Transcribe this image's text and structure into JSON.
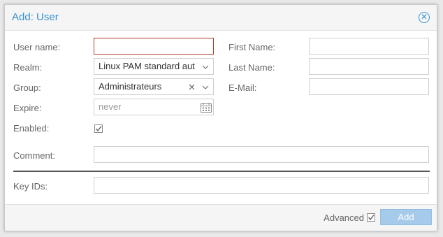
{
  "dialog": {
    "title": "Add: User",
    "close_icon": "close-circle-icon"
  },
  "form": {
    "user_name": {
      "label": "User name:",
      "value": ""
    },
    "realm": {
      "label": "Realm:",
      "value": "Linux PAM standard aut"
    },
    "group": {
      "label": "Group:",
      "value": "Administrateurs"
    },
    "expire": {
      "label": "Expire:",
      "placeholder": "never"
    },
    "enabled": {
      "label": "Enabled:",
      "checked": true
    },
    "first_name": {
      "label": "First Name:",
      "value": ""
    },
    "last_name": {
      "label": "Last Name:",
      "value": ""
    },
    "email": {
      "label": "E-Mail:",
      "value": ""
    },
    "comment": {
      "label": "Comment:",
      "value": ""
    },
    "key_ids": {
      "label": "Key IDs:",
      "value": ""
    }
  },
  "footer": {
    "advanced_label": "Advanced",
    "advanced_checked": true,
    "add_label": "Add"
  },
  "colors": {
    "accent": "#3892d3",
    "invalid_border": "#b33c26",
    "button_disabled": "#a6cbea"
  }
}
